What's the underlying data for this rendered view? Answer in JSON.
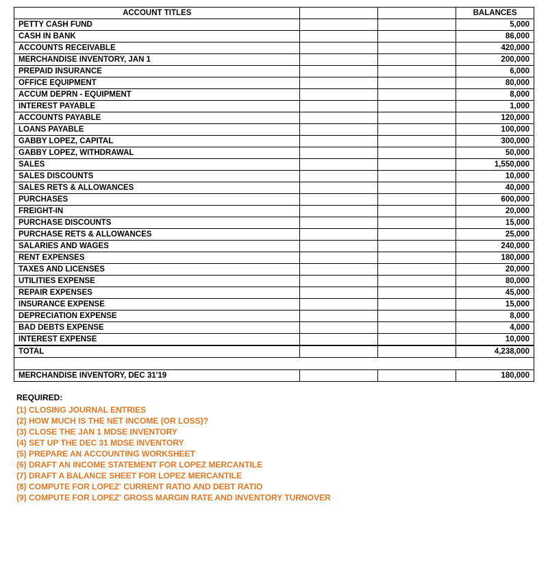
{
  "table": {
    "headers": [
      "ACCOUNT TITLES",
      "",
      "BALANCES"
    ],
    "rows": [
      {
        "account": "PETTY CASH FUND",
        "debit": "",
        "credit": "",
        "balance": "5,000"
      },
      {
        "account": "CASH IN BANK",
        "debit": "",
        "credit": "",
        "balance": "86,000"
      },
      {
        "account": "ACCOUNTS RECEIVABLE",
        "debit": "",
        "credit": "",
        "balance": "420,000"
      },
      {
        "account": "MERCHANDISE INVENTORY, JAN 1",
        "debit": "",
        "credit": "",
        "balance": "200,000"
      },
      {
        "account": "PREPAID INSURANCE",
        "debit": "",
        "credit": "",
        "balance": "6,000"
      },
      {
        "account": "OFFICE EQUIPMENT",
        "debit": "",
        "credit": "",
        "balance": "80,000"
      },
      {
        "account": "ACCUM DEPRN - EQUIPMENT",
        "debit": "",
        "credit": "",
        "balance": "8,000"
      },
      {
        "account": "INTEREST PAYABLE",
        "debit": "",
        "credit": "",
        "balance": "1,000"
      },
      {
        "account": "ACCOUNTS PAYABLE",
        "debit": "",
        "credit": "",
        "balance": "120,000"
      },
      {
        "account": "LOANS PAYABLE",
        "debit": "",
        "credit": "",
        "balance": "100,000"
      },
      {
        "account": "GABBY LOPEZ, CAPITAL",
        "debit": "",
        "credit": "",
        "balance": "300,000"
      },
      {
        "account": "GABBY LOPEZ, WITHDRAWAL",
        "debit": "",
        "credit": "",
        "balance": "50,000"
      },
      {
        "account": "SALES",
        "debit": "",
        "credit": "",
        "balance": "1,550,000"
      },
      {
        "account": "SALES DISCOUNTS",
        "debit": "",
        "credit": "",
        "balance": "10,000"
      },
      {
        "account": "SALES RETS & ALLOWANCES",
        "debit": "",
        "credit": "",
        "balance": "40,000"
      },
      {
        "account": "PURCHASES",
        "debit": "",
        "credit": "",
        "balance": "600,000"
      },
      {
        "account": "FREIGHT-IN",
        "debit": "",
        "credit": "",
        "balance": "20,000"
      },
      {
        "account": "PURCHASE DISCOUNTS",
        "debit": "",
        "credit": "",
        "balance": "15,000"
      },
      {
        "account": "PURCHASE RETS & ALLOWANCES",
        "debit": "",
        "credit": "",
        "balance": "25,000"
      },
      {
        "account": "SALARIES AND WAGES",
        "debit": "",
        "credit": "",
        "balance": "240,000"
      },
      {
        "account": "RENT EXPENSES",
        "debit": "",
        "credit": "",
        "balance": "180,000"
      },
      {
        "account": "TAXES AND LICENSES",
        "debit": "",
        "credit": "",
        "balance": "20,000"
      },
      {
        "account": "UTILITIES EXPENSE",
        "debit": "",
        "credit": "",
        "balance": "80,000"
      },
      {
        "account": "REPAIR EXPENSES",
        "debit": "",
        "credit": "",
        "balance": "45,000"
      },
      {
        "account": "INSURANCE EXPENSE",
        "debit": "",
        "credit": "",
        "balance": "15,000"
      },
      {
        "account": "DEPRECIATION EXPENSE",
        "debit": "",
        "credit": "",
        "balance": "8,000"
      },
      {
        "account": "BAD DEBTS EXPENSE",
        "debit": "",
        "credit": "",
        "balance": "4,000"
      },
      {
        "account": "INTEREST EXPENSE",
        "debit": "",
        "credit": "",
        "balance": "10,000"
      },
      {
        "account": "TOTAL",
        "debit": "",
        "credit": "",
        "balance": "4,238,000"
      },
      {
        "account": "MERCHANDISE INVENTORY, DEC 31'19",
        "debit": "",
        "credit": "",
        "balance": "180,000"
      }
    ],
    "spacer_label": "",
    "mdse_label": "MERCHANDISE INVENTORY, DEC 31'19",
    "mdse_balance": "180,000"
  },
  "required": {
    "label": "REQUIRED:",
    "items": [
      {
        "num": "(1)",
        "text": "CLOSING JOURNAL ENTRIES"
      },
      {
        "num": "(2)",
        "text": "HOW MUCH IS THE NET INCOME (OR LOSS)?"
      },
      {
        "num": "(3)",
        "text": "CLOSE THE JAN 1 MDSE INVENTORY"
      },
      {
        "num": "(4)",
        "text": "SET UP THE DEC 31 MDSE INVENTORY"
      },
      {
        "num": "(5)",
        "text": "PREPARE AN ACCOUNTING WORKSHEET"
      },
      {
        "num": "(6)",
        "text": "DRAFT AN INCOME STATEMENT FOR LOPEZ MERCANTILE"
      },
      {
        "num": "(7)",
        "text": "DRAFT A BALANCE SHEET FOR LOPEZ MERCANTILE"
      },
      {
        "num": "(8)",
        "text": "COMPUTE FOR LOPEZ' CURRENT RATIO AND DEBT RATIO"
      },
      {
        "num": "(9)",
        "text": "COMPUTE FOR LOPEZ' GROSS MARGIN RATE AND INVENTORY TURNOVER"
      }
    ]
  }
}
